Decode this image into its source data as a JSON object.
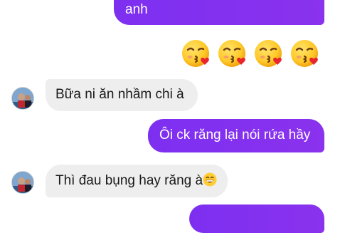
{
  "conversation": {
    "messages": [
      {
        "side": "outgoing",
        "text": "anh"
      },
      {
        "side": "outgoing",
        "emoji_name": "face-blowing-a-kiss",
        "emoji_count": 4
      },
      {
        "side": "incoming",
        "text": "Bữa ni ăn nhầm chi à"
      },
      {
        "side": "outgoing",
        "text": "Ôi ck răng lại nói rứa hầy"
      },
      {
        "side": "incoming",
        "text": "Thì đau bụng hay răng à",
        "trailing_emoji": "grinning-face-icon"
      },
      {
        "side": "outgoing",
        "text": ""
      }
    ]
  },
  "theme": {
    "outgoing_bubble_color": "#8232ee",
    "incoming_bubble_color": "#eeeeef",
    "outgoing_text_color": "#ffffff",
    "incoming_text_color": "#1a1a1a"
  },
  "icons": {
    "kiss": "kiss-emoji-icon",
    "avatar": "contact-avatar"
  }
}
